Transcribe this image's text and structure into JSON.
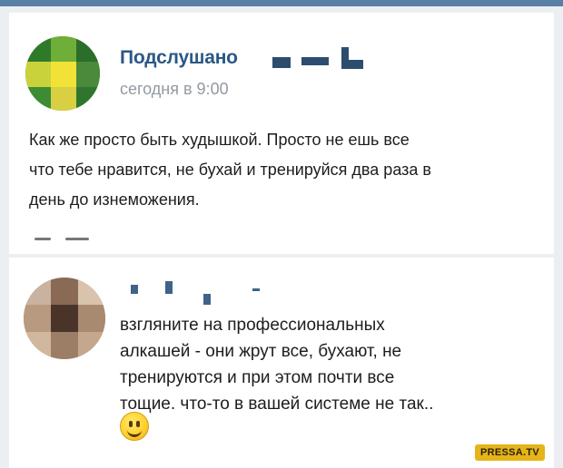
{
  "post": {
    "author": "Подслушано",
    "time": "сегодня в 9:00",
    "text_lines": [
      "Как же просто быть худышкой. Просто не ешь все",
      "что тебе нравится, не бухай и тренируйся два раза в",
      "день до изнеможения."
    ]
  },
  "comment": {
    "text_lines": [
      "взгляните на профессиональных",
      "алкашей - они жрут все, бухают, не",
      "тренируются и при этом почти все",
      "тощие. что-то в вашей системе не так.."
    ],
    "emoji": "smiling-face"
  },
  "watermark": "PRESSA.TV",
  "colors": {
    "accent": "#2a5885",
    "topbar": "#5a7fa6",
    "meta": "#939aa3",
    "text": "#1b1d20",
    "watermark_bg": "#e5b419"
  }
}
